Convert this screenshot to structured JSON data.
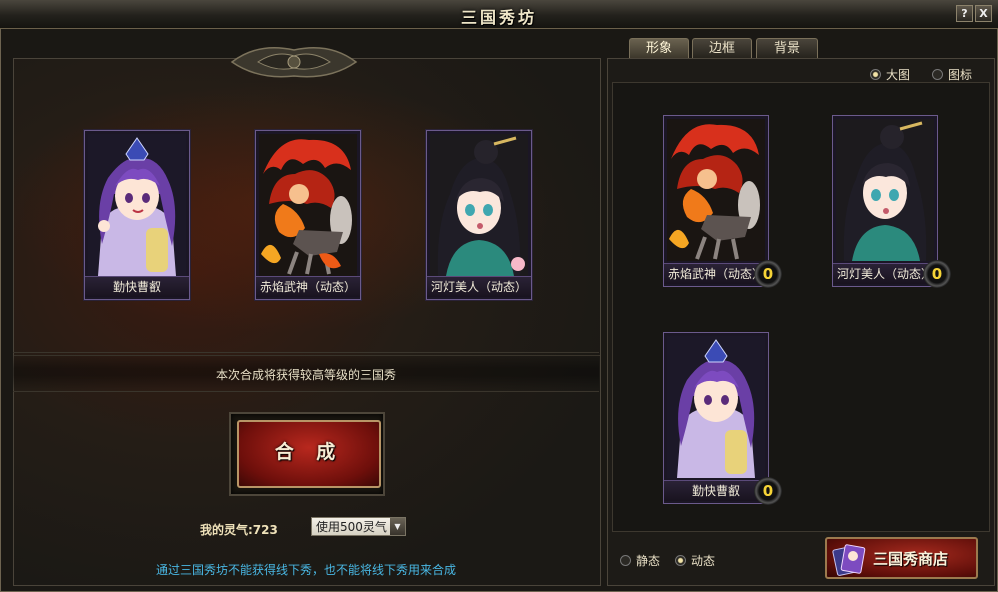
{
  "window": {
    "title": "三国秀坊",
    "help_label": "?",
    "close_label": "X"
  },
  "synthesis": {
    "slots": [
      {
        "name": "勤快曹叡",
        "figure": "purple-hair-character"
      },
      {
        "name": "赤焰武神（动态）",
        "figure": "flaming-warrior-on-horse"
      },
      {
        "name": "河灯美人（动态）",
        "figure": "dark-hair-lady"
      }
    ],
    "info_text": "本次合成将获得较高等级的三国秀",
    "button_label": "合 成",
    "spirit_label": "我的灵气:723",
    "use_select": "使用500灵气",
    "hint": "通过三国秀坊不能获得线下秀，也不能将线下秀用来合成"
  },
  "right": {
    "tabs": [
      {
        "label": "形象",
        "active": true
      },
      {
        "label": "边框",
        "active": false
      },
      {
        "label": "背景",
        "active": false
      }
    ],
    "view_options": [
      {
        "label": "大图",
        "selected": true
      },
      {
        "label": "图标",
        "selected": false
      }
    ],
    "gallery": [
      {
        "name": "赤焰武神（动态）",
        "count": "0",
        "figure": "flaming-warrior-on-horse"
      },
      {
        "name": "河灯美人（动态）",
        "count": "0",
        "figure": "dark-hair-lady"
      },
      {
        "name": "勤快曹叡",
        "count": "0",
        "figure": "purple-hair-character"
      }
    ],
    "mode_options": [
      {
        "label": "静态",
        "selected": false
      },
      {
        "label": "动态",
        "selected": true
      }
    ],
    "shop_label": "三国秀商店"
  },
  "colors": {
    "accent_red": "#8a1410",
    "hint_blue": "#49b7e3",
    "badge_yellow": "#f6d437",
    "card_border": "#6b5a8c"
  }
}
